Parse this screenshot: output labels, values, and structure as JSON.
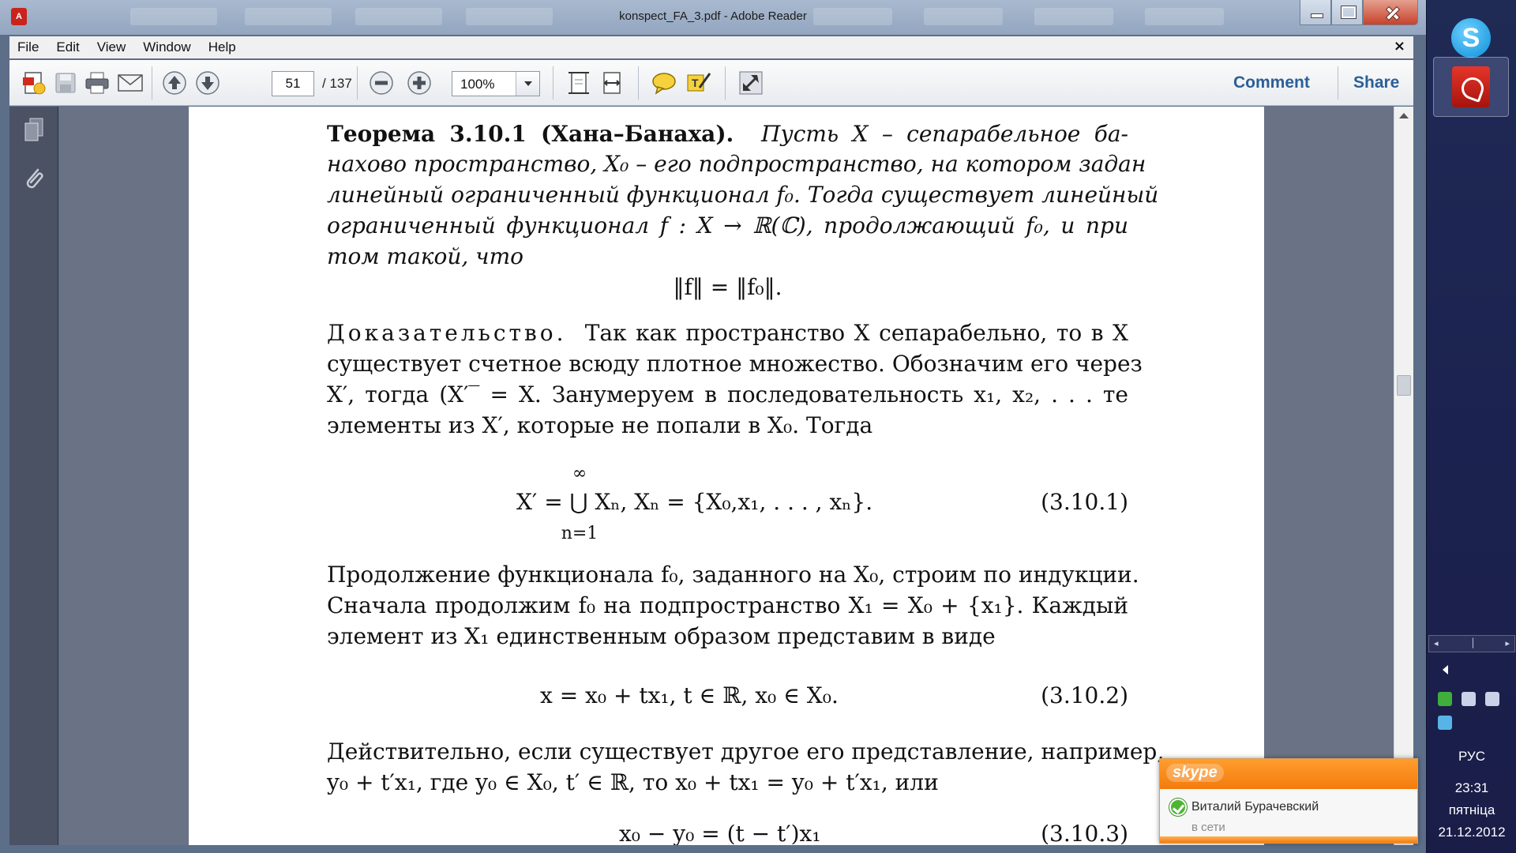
{
  "window": {
    "title": "konspect_FA_3.pdf - Adobe Reader",
    "app_icon": "pdf-icon"
  },
  "menu": {
    "items": [
      "File",
      "Edit",
      "View",
      "Window",
      "Help"
    ],
    "close_glyph": "×"
  },
  "toolbar": {
    "page_current": "51",
    "page_total": "/ 137",
    "zoom": "100%",
    "comment": "Comment",
    "share": "Share",
    "icons": [
      "create-pdf-icon",
      "save-icon",
      "print-icon",
      "email-icon",
      "previous-page-icon",
      "next-page-icon",
      "zoom-out-icon",
      "zoom-in-icon",
      "fit-page-icon",
      "fit-width-icon",
      "sticky-note-icon",
      "highlight-icon",
      "full-screen-icon"
    ]
  },
  "leftpane": {
    "icons": [
      "pages-icon",
      "attachments-icon"
    ]
  },
  "document": {
    "theorem_heading": "Теорема 3.10.1 (Хана–Банаха).",
    "lines": [
      "Пусть X – сепарабельное ба-",
      "нахово пространство, X₀ – его подпространство, на котором задан",
      "линейный ограниченный функционал f₀. Тогда существует линейный",
      "ограниченный функционал f : X → ℝ(ℂ), продолжающий f₀, и при",
      "том такой, что"
    ],
    "norm_equation": "‖f‖ = ‖f₀‖.",
    "proof_word": "Доказательство.",
    "proof_lines": [
      "Так как пространство X сепарабельно, то в X",
      "существует счетное всюду плотное множество. Обозначим его через",
      "X′, тогда (X′‾ = X. Занумеруем в последовательность x₁, x₂, . . . те",
      "элементы из X′, которые не попали в X₀. Тогда"
    ],
    "eq1": {
      "upper": "∞",
      "main": "X′ = ⋃ Xₙ,   Xₙ = {X₀,x₁, . . . , xₙ}.",
      "lower": "n=1",
      "number": "(3.10.1)"
    },
    "para2": [
      "Продолжение функционала f₀, заданного на X₀, строим по индукции.",
      "Сначала продолжим f₀ на подпространство X₁ = X₀ + {x₁}. Каждый",
      "элемент из X₁ единственным образом представим в виде"
    ],
    "eq2": {
      "main": "x = x₀ + tx₁,    t ∈ ℝ,    x₀ ∈ X₀.",
      "number": "(3.10.2)"
    },
    "para3": [
      "Действительно, если существует другое его представление, например,",
      "y₀ + t′x₁, где y₀ ∈ X₀, t′ ∈ ℝ, то x₀ + tx₁ = y₀ + t′x₁, или"
    ],
    "eq3": {
      "main": "x₀ − y₀ = (t − t′)x₁",
      "number": "(3.10.3)"
    }
  },
  "taskbar": {
    "apps": [
      "skype-icon",
      "adobe-reader-icon"
    ],
    "language": "РУС",
    "time": "23:31",
    "day": "пятніца",
    "date": "21.12.2012"
  },
  "notification": {
    "app": "skype",
    "contact": "Виталий Бурачевский",
    "status": "в сети"
  },
  "colors": {
    "link": "#2b5f97",
    "toast_orange": "#f47b0d",
    "online_green": "#4db534"
  }
}
